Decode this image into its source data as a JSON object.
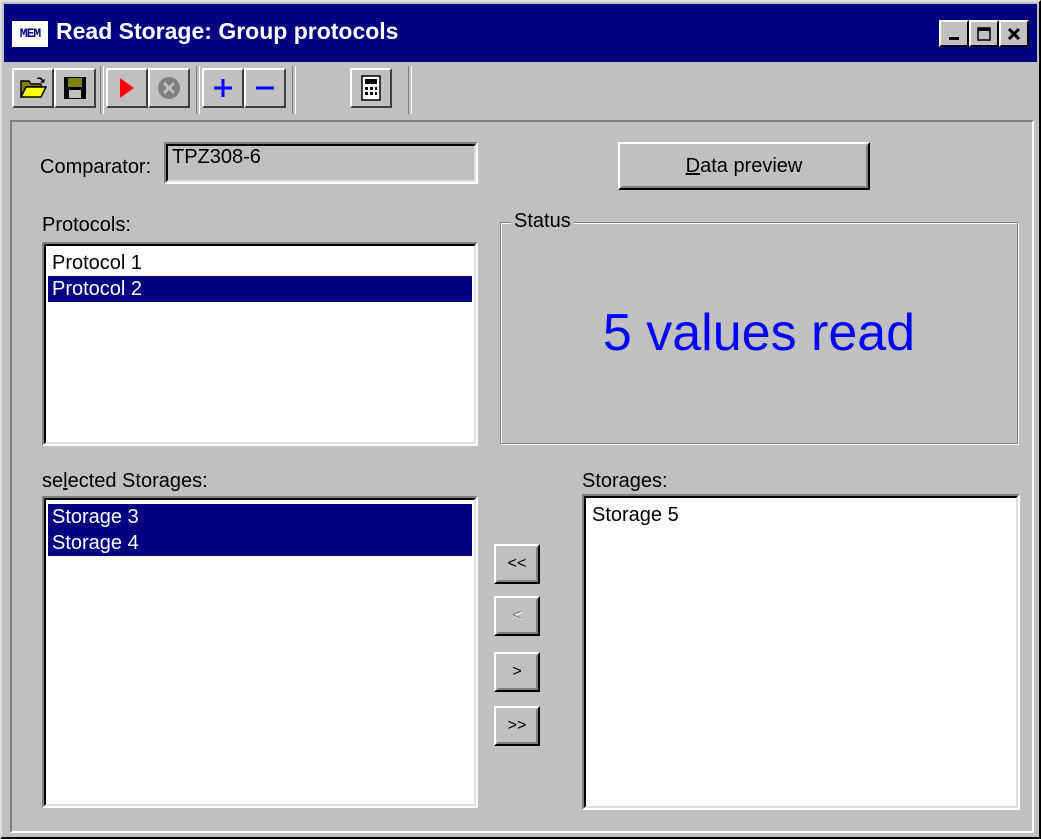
{
  "window": {
    "app_icon_text": "MEM",
    "title": "Read Storage: Group protocols",
    "controls": [
      "minimize-icon",
      "maximize-icon",
      "close-icon"
    ]
  },
  "toolbar": {
    "buttons": [
      {
        "name": "open-button",
        "icon": "folder-open-icon"
      },
      {
        "name": "save-button",
        "icon": "floppy-disk-icon"
      },
      {
        "name": "start-button",
        "icon": "play-icon",
        "color": "#ff0000"
      },
      {
        "name": "stop-button",
        "icon": "cancel-icon",
        "enabled": false
      },
      {
        "name": "add-button",
        "icon": "plus-icon",
        "color": "#0000ff"
      },
      {
        "name": "remove-button",
        "icon": "minus-icon",
        "color": "#0000ff"
      },
      {
        "name": "calculator-button",
        "icon": "calculator-icon"
      }
    ]
  },
  "comparator": {
    "label": "Comparator:",
    "value": "TPZ308-6"
  },
  "data_preview": {
    "label_prefix": "",
    "label_mnemonic": "D",
    "label_rest": "ata preview"
  },
  "protocols": {
    "label": "Protocols:",
    "items": [
      {
        "label": "Protocol 1",
        "selected": false
      },
      {
        "label": "Protocol 2",
        "selected": true
      }
    ]
  },
  "status": {
    "legend": "Status",
    "message": "5 values read",
    "message_color": "#0000ff"
  },
  "selected_storages": {
    "label_prefix": "se",
    "label_mnemonic": "l",
    "label_rest": "ected Storages:",
    "items": [
      {
        "label": "Storage 3",
        "selected": true
      },
      {
        "label": "Storage 4",
        "selected": true
      }
    ]
  },
  "storages": {
    "label": "Storages:",
    "items": [
      {
        "label": "Storage 5",
        "selected": false
      }
    ]
  },
  "transfer_buttons": {
    "add_all": "<<",
    "add_one": "<",
    "remove_one": ">",
    "remove_all": ">>"
  },
  "colors": {
    "titlebar": "#000080",
    "face": "#c0c0c0",
    "selection": "#000080"
  }
}
